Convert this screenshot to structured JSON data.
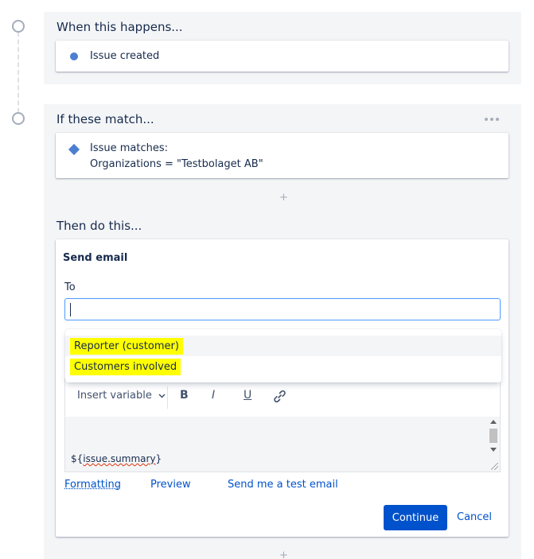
{
  "trigger": {
    "title": "When this happens...",
    "item": "Issue created"
  },
  "condition": {
    "title": "If these match...",
    "line1": "Issue matches:",
    "line2": "Organizations = \"Testbolaget AB\"",
    "add": "+"
  },
  "action": {
    "title": "Then do this...",
    "card_title": "Send email",
    "to_label": "To",
    "to_value": "",
    "dropdown": [
      {
        "label": "Reporter (customer)"
      },
      {
        "label": "Customers involved"
      }
    ],
    "toolbar": {
      "insert_variable": "Insert variable",
      "bold": "B",
      "italic": "I",
      "underline": "U"
    },
    "editor_prefix": "${",
    "editor_var": "issue.summary",
    "editor_suffix": "}",
    "links": {
      "formatting": "Formatting",
      "preview": "Preview",
      "test_email": "Send me a test email"
    },
    "continue": "Continue",
    "cancel": "Cancel",
    "add": "+"
  },
  "colors": {
    "accent": "#0052cc",
    "highlight": "#ffff00",
    "icon": "#4c7fd1"
  }
}
